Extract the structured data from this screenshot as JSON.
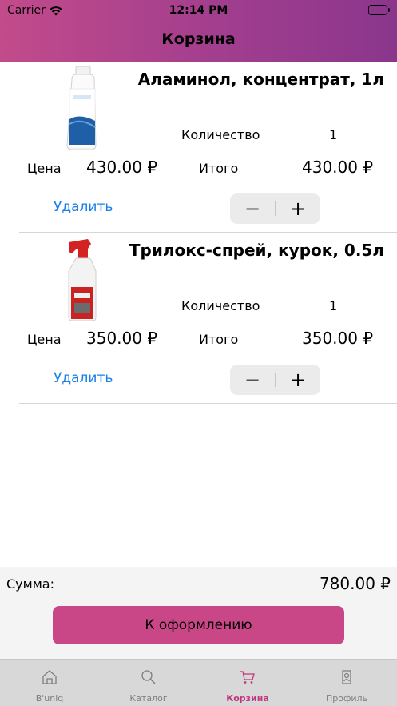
{
  "status_bar": {
    "carrier": "Carrier",
    "time": "12:14 PM"
  },
  "nav": {
    "title": "Корзина"
  },
  "cart": {
    "items": [
      {
        "name": "Аламинол, концентрат, 1л",
        "qty_label": "Количество",
        "qty": "1",
        "price_label": "Цена",
        "price": "430.00 ₽",
        "total_label": "Итого",
        "total": "430.00 ₽",
        "delete_label": "Удалить",
        "minus": "−",
        "plus": "+"
      },
      {
        "name": "Трилокс-спрей, курок, 0.5л",
        "qty_label": "Количество",
        "qty": "1",
        "price_label": "Цена",
        "price": "350.00 ₽",
        "total_label": "Итого",
        "total": "350.00 ₽",
        "delete_label": "Удалить",
        "minus": "−",
        "plus": "+"
      }
    ]
  },
  "summary": {
    "label": "Сумма:",
    "value": "780.00 ₽",
    "checkout_label": "К оформлению"
  },
  "tabs": [
    {
      "label": "B'uniq",
      "icon": "home-icon"
    },
    {
      "label": "Каталог",
      "icon": "search-icon"
    },
    {
      "label": "Корзина",
      "icon": "cart-icon",
      "active": true
    },
    {
      "label": "Профиль",
      "icon": "profile-icon"
    }
  ],
  "colors": {
    "accent": "#c94787",
    "header_start": "#c24b8b",
    "header_end": "#8a368d",
    "link": "#1a7fe8",
    "active_tab": "#c2367d"
  }
}
